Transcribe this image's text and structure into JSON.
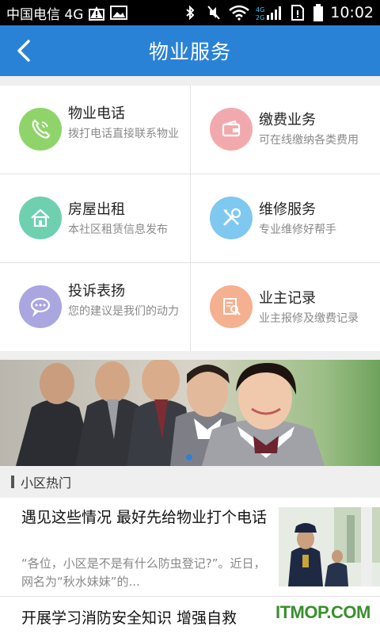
{
  "status_bar": {
    "carrier": "中国电信 4G",
    "time": "10:02",
    "icons": [
      "warning-icon",
      "image-icon",
      "bluetooth-icon",
      "mute-icon",
      "wifi-icon",
      "signal-icon",
      "sim-icon",
      "battery-icon"
    ],
    "net_label": "4G 2G"
  },
  "appbar": {
    "title": "物业服务"
  },
  "services": [
    {
      "title": "物业电话",
      "subtitle": "拨打电话直接联系物业",
      "icon": "phone-icon",
      "color": "#8fd46b"
    },
    {
      "title": "缴费业务",
      "subtitle": "可在线缴纳各类费用",
      "icon": "wallet-icon",
      "color": "#f2a9ad"
    },
    {
      "title": "房屋出租",
      "subtitle": "本社区租赁信息发布",
      "icon": "house-icon",
      "color": "#6fd0b0"
    },
    {
      "title": "维修服务",
      "subtitle": "专业维修好帮手",
      "icon": "tools-icon",
      "color": "#7fc8ef"
    },
    {
      "title": "投诉表扬",
      "subtitle": "您的建议是我们的动力",
      "icon": "chat-icon",
      "color": "#a9a6e0"
    },
    {
      "title": "业主记录",
      "subtitle": "业主报修及缴费记录",
      "icon": "record-search-icon",
      "color": "#f5b08f"
    }
  ],
  "section": {
    "label": "小区热门"
  },
  "news": [
    {
      "title": "遇见这些情况 最好先给物业打个电话",
      "summary": "“各位，小区是不是有什么防虫登记?”。近日，网名为“秋水妹妹”的..."
    },
    {
      "title": "开展学习消防安全知识 增强自救"
    }
  ],
  "watermark": "ITMOP.COM",
  "colors": {
    "appbar": "#2a82d6",
    "background": "#efefef"
  }
}
